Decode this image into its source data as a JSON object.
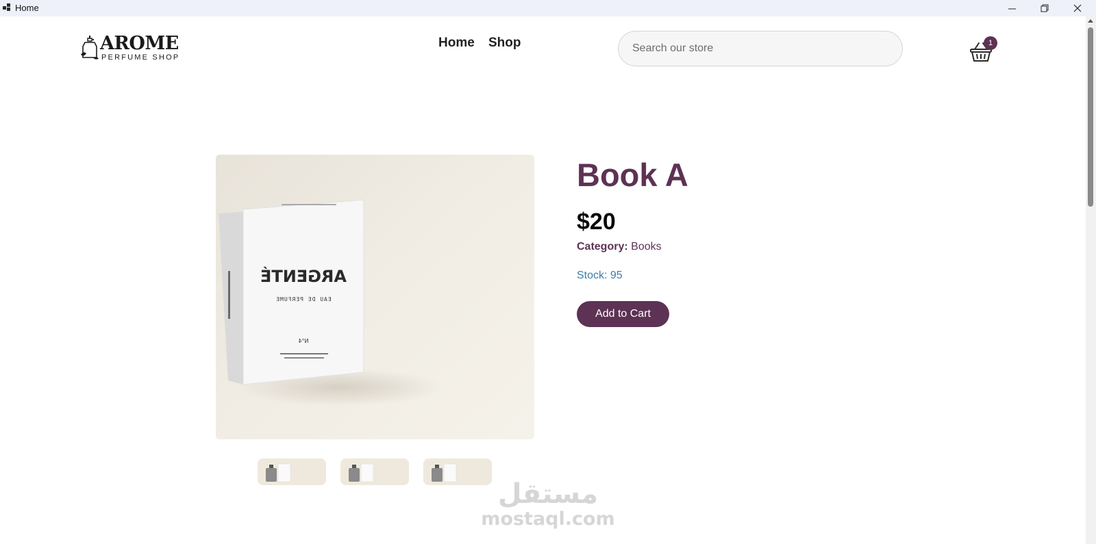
{
  "window": {
    "title": "Home",
    "controls": [
      "minimize-icon",
      "restore-icon",
      "close-icon"
    ]
  },
  "brand": {
    "name": "AROME",
    "tagline": "PERFUME SHOP"
  },
  "nav": {
    "items": [
      {
        "label": "Home"
      },
      {
        "label": "Shop"
      }
    ]
  },
  "search": {
    "placeholder": "Search our store",
    "value": ""
  },
  "cart": {
    "icon": "basket-icon",
    "count": "1"
  },
  "product": {
    "title": "Book A",
    "price": "$20",
    "category_label": "Category:",
    "category_value": "Books",
    "stock": "Stock: 95",
    "add_to_cart_label": "Add to Cart",
    "image": {
      "box_brand": "ARGENTÉ",
      "box_subtitle": "EAU DE PERFUME",
      "box_number": "N°4"
    },
    "thumbnails": 3
  },
  "watermark": {
    "arabic": "مستقل",
    "latin": "mostaql.com"
  },
  "colors": {
    "accent": "#5d3254",
    "stock": "#3e7bab",
    "titlebar": "#eef1f9"
  }
}
